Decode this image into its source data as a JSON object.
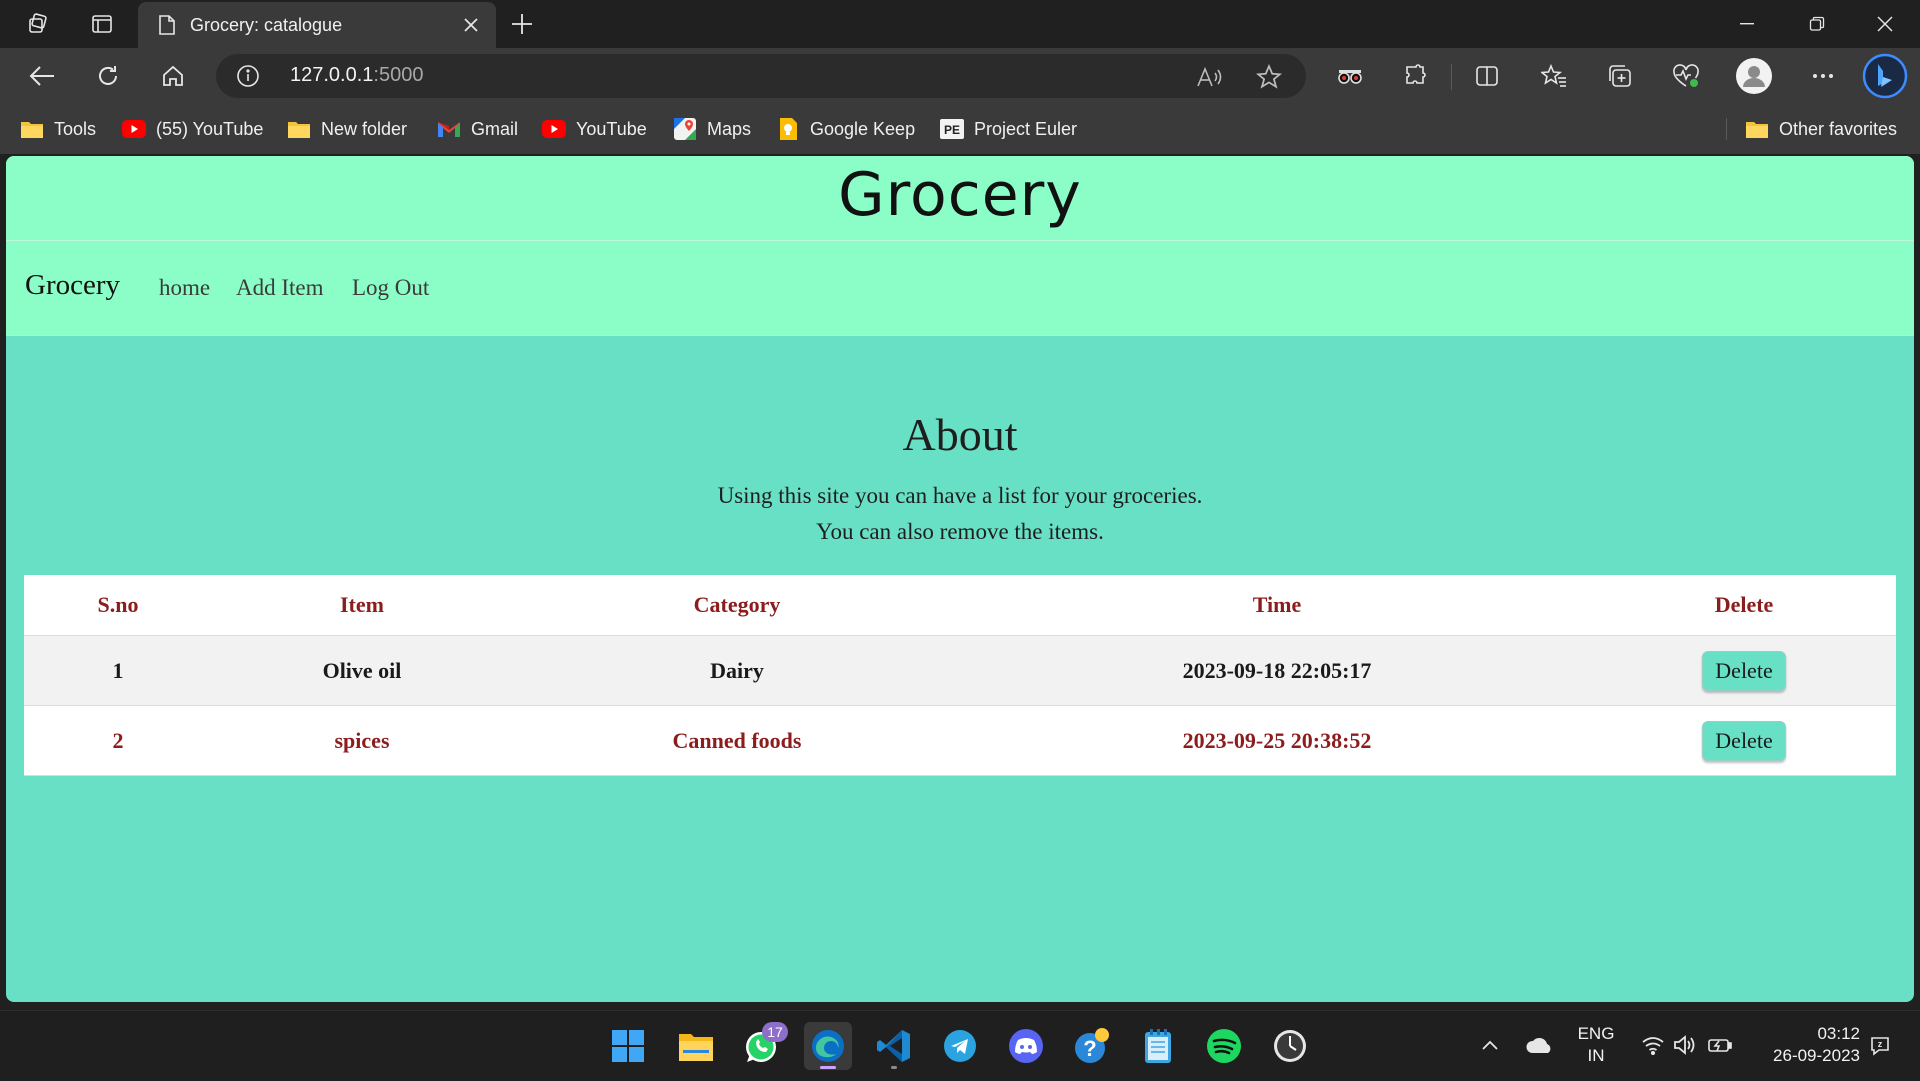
{
  "browser": {
    "tab_title": "Grocery: catalogue",
    "url_host": "127.0.0.1",
    "url_port": ":5000",
    "bookmarks": [
      {
        "label": "Tools",
        "icon": "folder-icon"
      },
      {
        "label": "(55) YouTube",
        "icon": "youtube-icon"
      },
      {
        "label": "New folder",
        "icon": "folder-icon"
      },
      {
        "label": "Gmail",
        "icon": "gmail-icon"
      },
      {
        "label": "YouTube",
        "icon": "youtube-icon"
      },
      {
        "label": "Maps",
        "icon": "maps-icon"
      },
      {
        "label": "Google Keep",
        "icon": "keep-icon"
      },
      {
        "label": "Project Euler",
        "icon": "project-euler-icon"
      }
    ],
    "other_favorites": "Other favorites"
  },
  "site": {
    "header_title": "Grocery",
    "brand": "Grocery",
    "nav": [
      "home",
      "Add Item",
      "Log Out"
    ],
    "about_title": "About",
    "desc_line1": "Using this site you can have a list for your groceries.",
    "desc_line2": "You can also remove the items."
  },
  "table": {
    "headers": [
      "S.no",
      "Item",
      "Category",
      "Time",
      "Delete"
    ],
    "rows": [
      {
        "sno": "1",
        "item": "Olive oil",
        "category": "Dairy",
        "time": "2023-09-18 22:05:17",
        "action": "Delete"
      },
      {
        "sno": "2",
        "item": "spices",
        "category": "Canned foods",
        "time": "2023-09-25 20:38:52",
        "action": "Delete"
      }
    ]
  },
  "taskbar": {
    "whatsapp_badge": "17",
    "lang_line1": "ENG",
    "lang_line2": "IN",
    "time": "03:12",
    "date": "26-09-2023"
  },
  "colors": {
    "page_bg": "#68e0c6",
    "header_bg": "#8afec6",
    "table_accent": "#8b1d1d"
  }
}
